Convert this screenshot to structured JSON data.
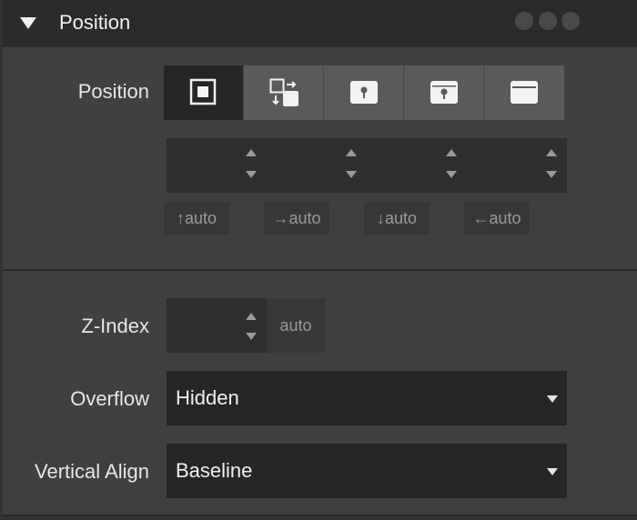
{
  "header": {
    "title": "Position"
  },
  "position": {
    "label": "Position",
    "modes": [
      "static",
      "relative",
      "absolute",
      "fixed",
      "sticky"
    ],
    "active_mode": "static",
    "offsets": [
      {
        "arrow": "↑",
        "value": "auto"
      },
      {
        "arrow": "→",
        "value": "auto"
      },
      {
        "arrow": "↓",
        "value": "auto"
      },
      {
        "arrow": "←",
        "value": "auto"
      }
    ]
  },
  "zindex": {
    "label": "Z-Index",
    "value": "",
    "placeholder": "auto"
  },
  "overflow": {
    "label": "Overflow",
    "value": "Hidden"
  },
  "vertical_align": {
    "label": "Vertical Align",
    "value": "Baseline"
  },
  "colors": {
    "panel": "#404040",
    "header": "#2b2b2b",
    "active_segment": "#262626",
    "segment": "#5a5a5a"
  }
}
